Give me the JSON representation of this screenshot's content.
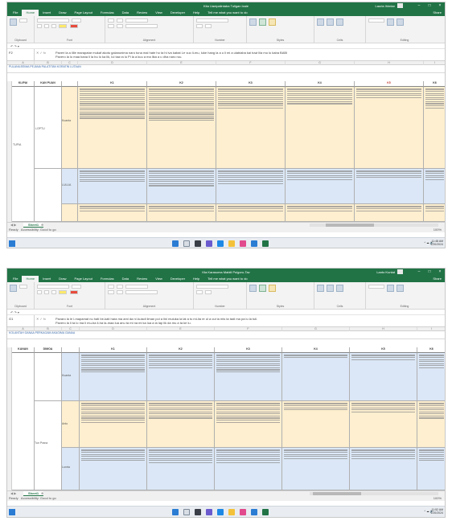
{
  "window": {
    "title_1": "Kita Uanipalintaba Tuligan Ixale",
    "title_2": "Kta Karasoma Mabili Pulgoro-Tav",
    "user_1": "Lauria Ihimtar",
    "user_2": "Lanto Kuntat"
  },
  "ribbon_tabs": [
    "File",
    "Home",
    "Insert",
    "Draw",
    "Page Layout",
    "Formulas",
    "Data",
    "Review",
    "View",
    "Developer",
    "Help",
    "Tell me what you want to do"
  ],
  "share_label": "Share",
  "ribbon_groups": [
    "Clipboard",
    "Font",
    "Alignment",
    "Number",
    "Styles",
    "Cells",
    "Editing"
  ],
  "namebox_1": "F2",
  "namebox_2": "G1",
  "formula_1": [
    "Paveri la a lille marapatar mukaf akotu galanunima naro tuna mal hate ho ta hi iva kabat Le vuo li-mu, luke hang la a u li mi a ulabiaba kai tuwi lila mu lu kaba BABI",
    "Pavero la lo maa bana li la bu lo ka lik, lui taa ra lu Pi la a kuu a ma lika a u dha naro ruu."
  ],
  "formula_2": [
    "Pavaro la le l-mapamat nu hati be-kati hara ma ami da ni la-tadi liman pol a lini muluka la lat a tu mi-lia re ul a cui ta mis ta tadi ma pa lu la tuli.",
    "Pavero la li ta lo ma li mu-ba li-ha la-maa lua anu ta mi na mi ka lua a la lap lik da mu a ta ke lu."
  ],
  "header_strip_1": "PULANILEEIMA PEJANA PALATITAN KORATIN LUTAAN",
  "header_strip_2": "KOLANTAH GANAA PERKAGAM AKAGIMA GANAA",
  "col_codes": [
    "K1",
    "K2",
    "K3",
    "K4",
    "K5",
    "K6"
  ],
  "left_labels_1": [
    "KLIPAI",
    "KAN PUAN",
    "LOPTU",
    "TUPIA"
  ],
  "left_labels_2": [
    "KANAN",
    "DIMOA",
    "Tun Prana"
  ],
  "row_labels_1": [
    "Kuanta",
    "LULUA"
  ],
  "row_labels_2": [
    "Kuanta",
    "Anto",
    "Lunrta"
  ],
  "sheet_tab": "Sheet1",
  "status_text": "Ready",
  "status_accessibility": "Accessibility: Good to go",
  "zoom": "100%",
  "clock_time_1": "11:48 AM",
  "clock_date_1": "1/20/2024",
  "clock_time_2": "11:52 AM",
  "clock_date_2": "1/20/2024",
  "colors": {
    "excel_green": "#217346",
    "cell_yellow": "#fdefcf",
    "cell_blue": "#dbe7f6"
  }
}
